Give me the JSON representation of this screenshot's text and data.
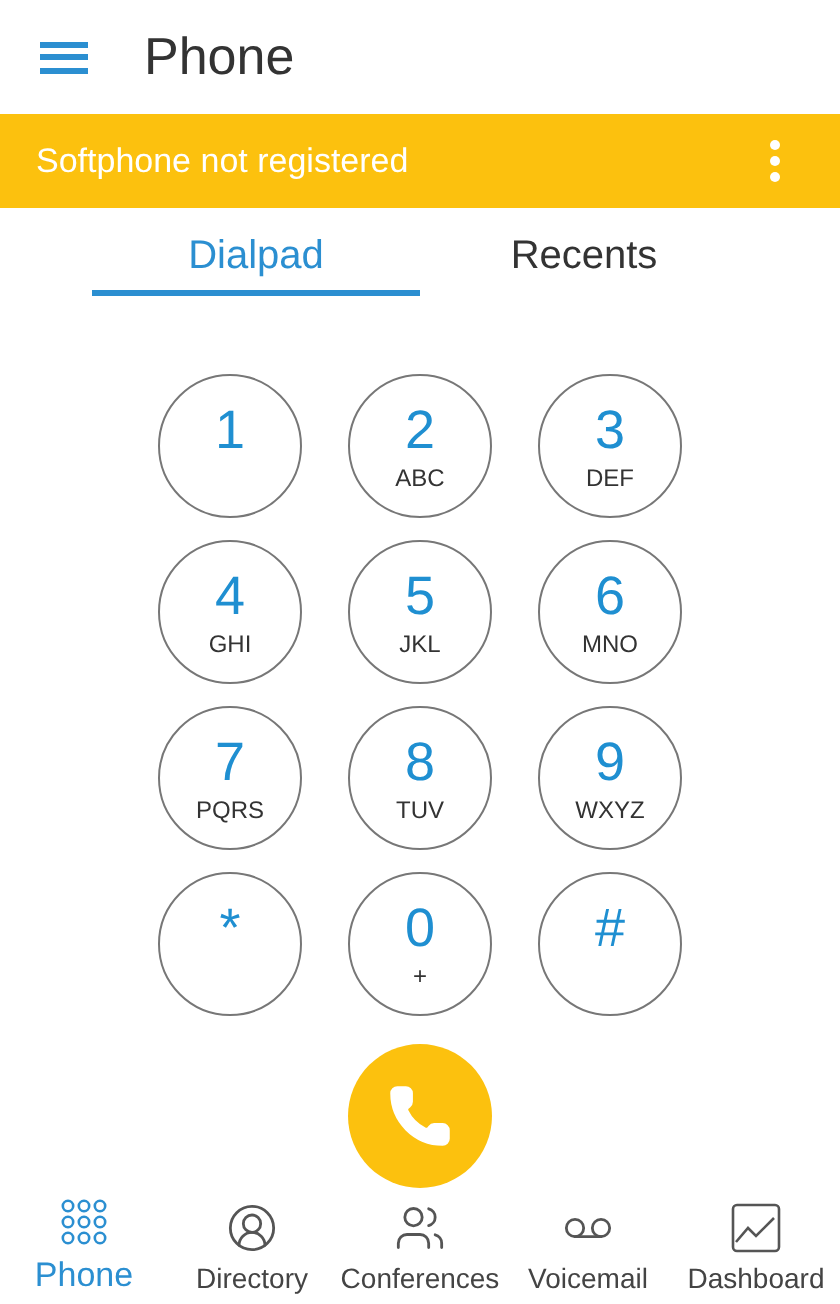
{
  "header": {
    "title": "Phone"
  },
  "banner": {
    "message": "Softphone not registered"
  },
  "tabs": [
    {
      "label": "Dialpad",
      "selected": true
    },
    {
      "label": "Recents",
      "selected": false
    }
  ],
  "keys": [
    {
      "digit": "1"
    },
    {
      "digit": "2",
      "letters": "ABC"
    },
    {
      "digit": "3",
      "letters": "DEF"
    },
    {
      "digit": "4",
      "letters": "GHI"
    },
    {
      "digit": "5",
      "letters": "JKL"
    },
    {
      "digit": "6",
      "letters": "MNO"
    },
    {
      "digit": "7",
      "letters": "PQRS"
    },
    {
      "digit": "8",
      "letters": "TUV"
    },
    {
      "digit": "9",
      "letters": "WXYZ"
    },
    {
      "digit": "*"
    },
    {
      "digit": "0",
      "letters": "+"
    },
    {
      "digit": "#"
    }
  ],
  "nav": [
    {
      "kind": "dialpad",
      "label": "Phone",
      "selected": true
    },
    {
      "kind": "directory",
      "label": "Directory",
      "selected": false
    },
    {
      "kind": "conferences",
      "label": "Conferences",
      "selected": false
    },
    {
      "kind": "voicemail",
      "label": "Voicemail",
      "selected": false
    },
    {
      "kind": "dashboard",
      "label": "Dashboard",
      "selected": false
    }
  ]
}
